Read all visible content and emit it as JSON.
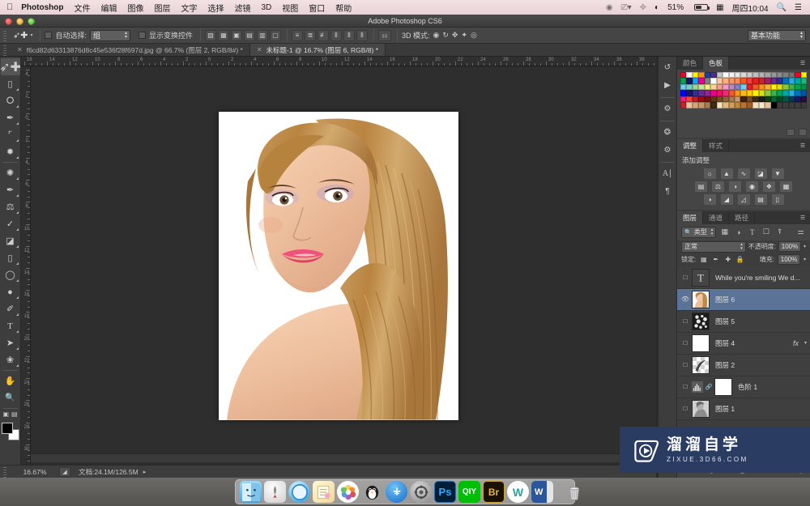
{
  "macbar": {
    "apple_icon": "apple-icon",
    "app_name": "Photoshop",
    "menus": [
      "文件",
      "编辑",
      "图像",
      "图层",
      "文字",
      "选择",
      "滤镜",
      "3D",
      "视图",
      "窗口",
      "帮助"
    ],
    "status": {
      "screen_icon": "airplay-icon",
      "display_icon": "display-icon",
      "bluetooth_icon": "bluetooth-icon",
      "wifi_icon": "wifi-icon",
      "battery_percent": "51%",
      "battery_icon": "battery-icon",
      "input_icon": "input-source-icon",
      "clock": "周四10:04",
      "search_icon": "search-icon",
      "notification_icon": "notification-center-icon"
    }
  },
  "window": {
    "title": "Adobe Photoshop CS6",
    "close_label": "close-button",
    "minimize_label": "minimize-button",
    "zoom_label": "zoom-button"
  },
  "options_bar": {
    "tool_icon": "move-tool-icon",
    "auto_select_label": "自动选择:",
    "auto_select_value": "组",
    "show_transform_label": "显示变换控件",
    "align_buttons": [
      "align-top-edges",
      "align-vertical-centers",
      "align-bottom-edges",
      "align-left-edges",
      "align-horizontal-centers",
      "align-right-edges"
    ],
    "distribute_buttons": [
      "distribute-top-edges",
      "distribute-vertical-centers",
      "distribute-bottom-edges",
      "distribute-left-edges",
      "distribute-horizontal-centers",
      "distribute-right-edges"
    ],
    "auto_align_label": "auto-align-layers",
    "mode_3d_label": "3D 模式:",
    "mode_3d_icons": [
      "orbit-3d",
      "roll-3d",
      "pan-3d",
      "slide-3d",
      "scale-3d"
    ],
    "workspace": "基本功能"
  },
  "tabs": [
    {
      "label": "f6cd82d63313876d8c45e536f28f697d.jpg @ 66.7% (图层 2, RGB/8#) *",
      "active": false
    },
    {
      "label": "未标题-1 @ 16.7% (图层 6, RGB/8) *",
      "active": true
    }
  ],
  "toolbar": {
    "tools": [
      {
        "name": "move-tool",
        "glyph": "⌖",
        "selected": true
      },
      {
        "name": "rectangular-marquee-tool",
        "glyph": "▭",
        "selected": false
      },
      {
        "name": "lasso-tool",
        "glyph": "◯",
        "selected": false
      },
      {
        "name": "quick-selection-tool",
        "glyph": "✎",
        "selected": false
      },
      {
        "name": "crop-tool",
        "glyph": "⌗",
        "selected": false
      },
      {
        "name": "eyedropper-tool",
        "glyph": "⌁",
        "selected": false
      },
      {
        "name": "spot-healing-brush-tool",
        "glyph": "✺",
        "selected": false
      },
      {
        "name": "brush-tool",
        "glyph": "✒",
        "selected": false
      },
      {
        "name": "clone-stamp-tool",
        "glyph": "⚒",
        "selected": false
      },
      {
        "name": "history-brush-tool",
        "glyph": "✍",
        "selected": false
      },
      {
        "name": "eraser-tool",
        "glyph": "◧",
        "selected": false
      },
      {
        "name": "gradient-tool",
        "glyph": "▤",
        "selected": false
      },
      {
        "name": "blur-tool",
        "glyph": "◌",
        "selected": false
      },
      {
        "name": "dodge-tool",
        "glyph": "●",
        "selected": false
      },
      {
        "name": "pen-tool",
        "glyph": "✑",
        "selected": false
      },
      {
        "name": "horizontal-type-tool",
        "glyph": "T",
        "selected": false
      },
      {
        "name": "path-selection-tool",
        "glyph": "➤",
        "selected": false
      },
      {
        "name": "custom-shape-tool",
        "glyph": "✿",
        "selected": false
      },
      {
        "name": "hand-tool",
        "glyph": "✋",
        "selected": false
      },
      {
        "name": "zoom-tool",
        "glyph": "🔍",
        "selected": false
      }
    ],
    "quick_mask_icon": "quick-mask-mode-icon",
    "screen_mode_icon": "screen-mode-icon",
    "foreground_color": "#000000",
    "background_color": "#ffffff"
  },
  "rulers": {
    "unit_hint": "cm",
    "h_ticks": [
      "16",
      "14",
      "12",
      "10",
      "8",
      "6",
      "4",
      "2",
      "0",
      "2",
      "4",
      "6",
      "8",
      "10",
      "12",
      "14",
      "16",
      "18",
      "20",
      "22",
      "24",
      "26",
      "28",
      "30",
      "32",
      "34",
      "36",
      "38"
    ],
    "v_ticks": [
      "4",
      "2",
      "0",
      "2",
      "4",
      "6",
      "8",
      "10",
      "12",
      "14",
      "16",
      "18",
      "20",
      "22",
      "24",
      "26",
      "28",
      "30"
    ]
  },
  "status_bar": {
    "zoom": "16.67%",
    "doc_info": "文档:24.1M/126.5M",
    "expand_icon": "expand-arrow-icon",
    "grip_icon": "resize-grip-icon"
  },
  "rail_icons": [
    "history-panel-icon",
    "actions-panel-icon",
    "properties-panel-icon",
    "brush-presets-panel-icon",
    "brush-panel-icon",
    "character-panel-icon",
    "paragraph-panel-icon"
  ],
  "color_panel": {
    "tabs": [
      {
        "label": "颜色",
        "active": false
      },
      {
        "label": "色板",
        "active": true
      }
    ],
    "menu_icon": "panel-menu-icon",
    "footer_buttons": [
      "new-swatch-icon",
      "delete-swatch-icon"
    ],
    "swatches": [
      [
        "#e8082a",
        "#ffffff",
        "#fff200",
        "#f7941e",
        "#21409a",
        "#4b2e83",
        "#c7c7c7",
        "#ffffff",
        "#f2f2f2",
        "#e6e6e6",
        "#d9d9d9",
        "#cccccc",
        "#bfbfbf",
        "#b3b3b3",
        "#a6a6a6",
        "#999999",
        "#8c8c8c",
        "#808080",
        "#737373",
        "#e8082a",
        "#fff200"
      ],
      [
        "#00a651",
        "#1b1464",
        "#00aeef",
        "#ec008c",
        "#808080",
        "#ffffff",
        "#f9c9a1",
        "#f8b07c",
        "#f79663",
        "#f68b5b",
        "#f15a24",
        "#ef4136",
        "#ed1c24",
        "#c1272d",
        "#9e1f63",
        "#662d91",
        "#2e3192",
        "#0071bc",
        "#29abe2",
        "#00a99d",
        "#22b573"
      ],
      [
        "#6dcff6",
        "#7accc8",
        "#a3d39c",
        "#c7e3a0",
        "#f9ed82",
        "#fbd69b",
        "#f7a08a",
        "#f49ac1",
        "#bd8cbf",
        "#8781bd",
        "#6dcff6",
        "#ed1c24",
        "#f15a24",
        "#f7941e",
        "#fbb03b",
        "#fff200",
        "#d9e021",
        "#8cc63f",
        "#39b54a",
        "#00a651",
        "#009245"
      ],
      [
        "#0000ff",
        "#1b1464",
        "#2e3192",
        "#662d91",
        "#92278f",
        "#ec008c",
        "#ed145b",
        "#ee2a7b",
        "#f15a29",
        "#f7931e",
        "#fdb913",
        "#ffcb05",
        "#fff200",
        "#d7df23",
        "#8dc63f",
        "#39b54a",
        "#00a651",
        "#00a79d",
        "#29abe2",
        "#0071bc",
        "#0054a6"
      ],
      [
        "#ed1e79",
        "#ef4136",
        "#be1e2d",
        "#9e0b0f",
        "#7a0e16",
        "#603913",
        "#754c24",
        "#8c6239",
        "#a67c52",
        "#c69c6d",
        "#42210b",
        "#754c24",
        "#3f2a14",
        "#1c1c1c",
        "#0f3d0f",
        "#006837",
        "#004b23",
        "#00573f",
        "#003a5d",
        "#1b1464",
        "#2b0b3f"
      ],
      [
        "#c1272d",
        "#e8c39e",
        "#d9a87a",
        "#c49a6c",
        "#a67c52",
        "#3d2a1a",
        "#f7e3c0",
        "#e2b87f",
        "#d2a05a",
        "#c08a3e",
        "#b87333",
        "#a35f23",
        "#f2dfc4",
        "#fbead0",
        "#e8c39e",
        "#000000",
        "#3d3d3d",
        "#3d3d3d",
        "#3d3d3d",
        "#3d3d3d",
        "#3d3d3d"
      ]
    ]
  },
  "adjustments_panel": {
    "tabs": [
      {
        "label": "调整",
        "active": true
      },
      {
        "label": "样式",
        "active": false
      }
    ],
    "menu_icon": "panel-menu-icon",
    "title": "添加调整",
    "rows": [
      [
        "brightness-contrast-icon",
        "levels-icon",
        "curves-icon",
        "exposure-icon",
        "vibrance-icon"
      ],
      [
        "hue-saturation-icon",
        "color-balance-icon",
        "black-white-icon",
        "photo-filter-icon",
        "channel-mixer-icon",
        "color-lookup-icon"
      ],
      [
        "invert-icon",
        "posterize-icon",
        "threshold-icon",
        "gradient-map-icon",
        "selective-color-icon"
      ]
    ]
  },
  "layers_panel": {
    "tabs": [
      {
        "label": "图层",
        "active": true
      },
      {
        "label": "通道",
        "active": false
      },
      {
        "label": "路径",
        "active": false
      }
    ],
    "menu_icon": "panel-menu-icon",
    "filter": {
      "search_icon": "filter-search-icon",
      "type_value": "类型",
      "icons": [
        "filter-pixel-icon",
        "filter-adjustment-icon",
        "filter-type-icon",
        "filter-shape-icon",
        "filter-smart-object-icon"
      ],
      "toggle_icon": "filter-toggle-icon"
    },
    "blend_mode": "正常",
    "opacity_label": "不透明度:",
    "opacity_value": "100%",
    "lock_label": "锁定:",
    "lock_icons": [
      "lock-transparent-pixels",
      "lock-image-pixels",
      "lock-position",
      "lock-all"
    ],
    "fill_label": "填充:",
    "fill_value": "100%",
    "layers": [
      {
        "name": "While you're smiling We d...",
        "type": "text",
        "visible": false,
        "selected": false,
        "fx": false
      },
      {
        "name": "图层 6",
        "type": "photo",
        "visible": true,
        "selected": true,
        "fx": false
      },
      {
        "name": "图层 5",
        "type": "mask",
        "visible": false,
        "selected": false,
        "fx": false
      },
      {
        "name": "图层 4",
        "type": "white",
        "visible": false,
        "selected": false,
        "fx": true
      },
      {
        "name": "图层 2",
        "type": "transparent",
        "visible": false,
        "selected": false,
        "fx": false
      },
      {
        "name": "色阶 1",
        "type": "levels",
        "visible": false,
        "selected": false,
        "fx": false
      },
      {
        "name": "图层 1",
        "type": "gray",
        "visible": false,
        "selected": false,
        "fx": false
      }
    ],
    "footer_buttons": [
      "link-layers-icon",
      "layer-style-icon",
      "layer-mask-icon",
      "new-adjustment-icon",
      "new-group-icon",
      "new-layer-icon",
      "delete-layer-icon"
    ]
  },
  "watermark": {
    "logo_icon": "play-button-logo",
    "title": "溜溜自学",
    "url": "ZIXUE.3D66.COM",
    "bg_color": "#2b3c63"
  },
  "dock": {
    "items": [
      {
        "name": "finder",
        "label": "",
        "color": "#3fa9f5",
        "running": true
      },
      {
        "name": "launchpad",
        "label": "",
        "color": "#d0d0d0",
        "running": false
      },
      {
        "name": "safari",
        "label": "",
        "color": "#2e9fe0",
        "running": true
      },
      {
        "name": "notes",
        "label": "",
        "color": "#f5deb3",
        "running": false
      },
      {
        "name": "photos",
        "label": "",
        "color": "#ffffff",
        "running": false
      },
      {
        "name": "qq",
        "label": "",
        "color": "#ffffff",
        "running": false
      },
      {
        "name": "app-store",
        "label": "",
        "color": "#1b7fe0",
        "running": false
      },
      {
        "name": "system-preferences",
        "label": "",
        "color": "#8d8d8d",
        "running": true
      },
      {
        "name": "photoshop",
        "label": "Ps",
        "color": "#001e36",
        "running": true
      },
      {
        "name": "iqiyi",
        "label": "QIY",
        "color": "#00be06",
        "running": true
      },
      {
        "name": "bridge",
        "label": "Br",
        "color": "#1a1100",
        "running": false
      },
      {
        "name": "wunderlist",
        "label": "W",
        "color": "#ffffff",
        "running": true
      },
      {
        "name": "word",
        "label": "W",
        "color": "#2b579a",
        "running": false
      }
    ],
    "trash": {
      "name": "trash",
      "label": ""
    }
  }
}
